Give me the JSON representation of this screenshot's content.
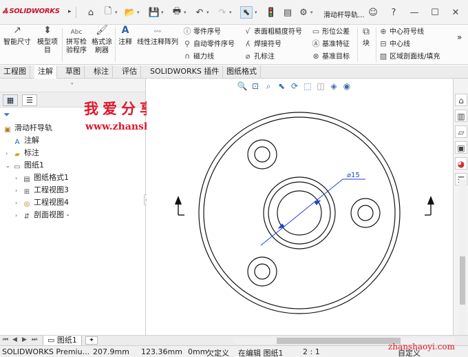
{
  "app": {
    "logo": "SOLIDWORKS",
    "title": "滑动杆导轨..."
  },
  "command_manager": {
    "big_buttons": [
      {
        "label1": "智能尺寸",
        "label2": "",
        "icon": "smart-dimension-icon"
      },
      {
        "label1": "模型项",
        "label2": "目",
        "icon": "model-items-icon"
      },
      {
        "label1": "拼写检",
        "label2": "验程序",
        "icon": "spell-check-icon"
      },
      {
        "label1": "格式涂",
        "label2": "刷器",
        "icon": "format-painter-icon"
      },
      {
        "label1": "注释",
        "label2": "",
        "icon": "note-icon"
      },
      {
        "label1": "线性注释阵列",
        "label2": "",
        "icon": "linear-note-pattern-icon"
      }
    ],
    "col1": [
      "零件序号",
      "自动零件序号",
      "磁力线"
    ],
    "col2": [
      "表面粗糙度符号",
      "焊接符号",
      "孔标注"
    ],
    "col3": [
      "形位公差",
      "基准特征",
      "基准目标"
    ],
    "block_label": "块",
    "col4": [
      "中心符号线",
      "中心线",
      "区域剖面线/填充"
    ]
  },
  "tabs": [
    "工程图",
    "注解",
    "草图",
    "标注",
    "评估",
    "SOLIDWORKS 插件",
    "图纸格式"
  ],
  "active_tab": "注解",
  "watermark": {
    "cn": "我爱分享网",
    "url": "www.zhanshaoyi.com",
    "status_url": "zhanshaoyi.com"
  },
  "tree": {
    "root": "滑动杆导轨",
    "items": [
      {
        "label": "注解",
        "level": 1
      },
      {
        "label": "标注",
        "level": 1
      },
      {
        "label": "图纸1",
        "level": 1
      },
      {
        "label": "图纸格式1",
        "level": 2
      },
      {
        "label": "工程视图3",
        "level": 2
      },
      {
        "label": "工程视图4",
        "level": 2
      },
      {
        "label": "剖面视图 -",
        "level": 2
      }
    ]
  },
  "drawing": {
    "dimension": "⌀15"
  },
  "sheet_tabs": [
    "图纸1"
  ],
  "status": {
    "app_name": "SOLIDWORKS Premiu...",
    "x": "207.9mm",
    "y": "123.36mm",
    "z": "0mm",
    "state": "欠定义",
    "editing": "在编辑 图纸1",
    "scale": "2 : 1",
    "custom": "自定义"
  }
}
